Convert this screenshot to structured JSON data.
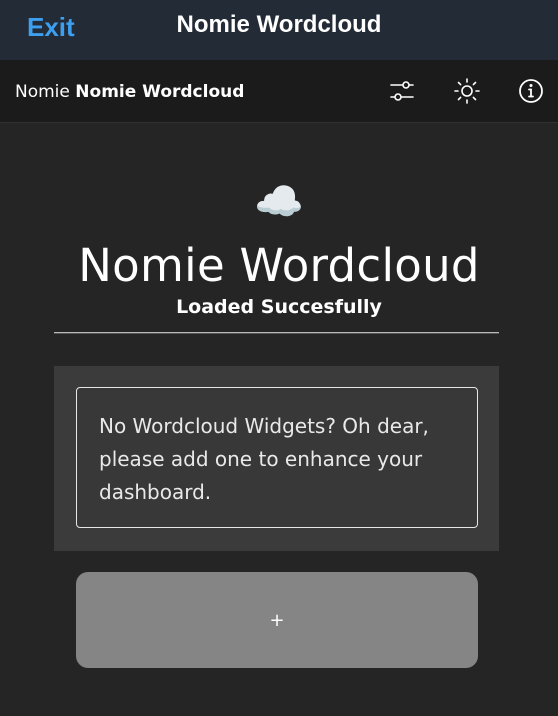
{
  "topbar": {
    "exit_label": "Exit",
    "title": "Nomie Wordcloud",
    "exit_color": "#3d9ff0"
  },
  "header": {
    "brand_prefix": "Nomie",
    "brand_name": "Nomie Wordcloud",
    "icons": [
      "sliders-icon",
      "sun-icon",
      "info-icon"
    ]
  },
  "hero": {
    "icon": "☁️",
    "title": "Nomie Wordcloud",
    "subtitle": "Loaded Succesfully"
  },
  "widgets": {
    "empty_message": "No Wordcloud Widgets? Oh dear, please add one to enhance your dashboard.",
    "add_button_label": "+"
  }
}
